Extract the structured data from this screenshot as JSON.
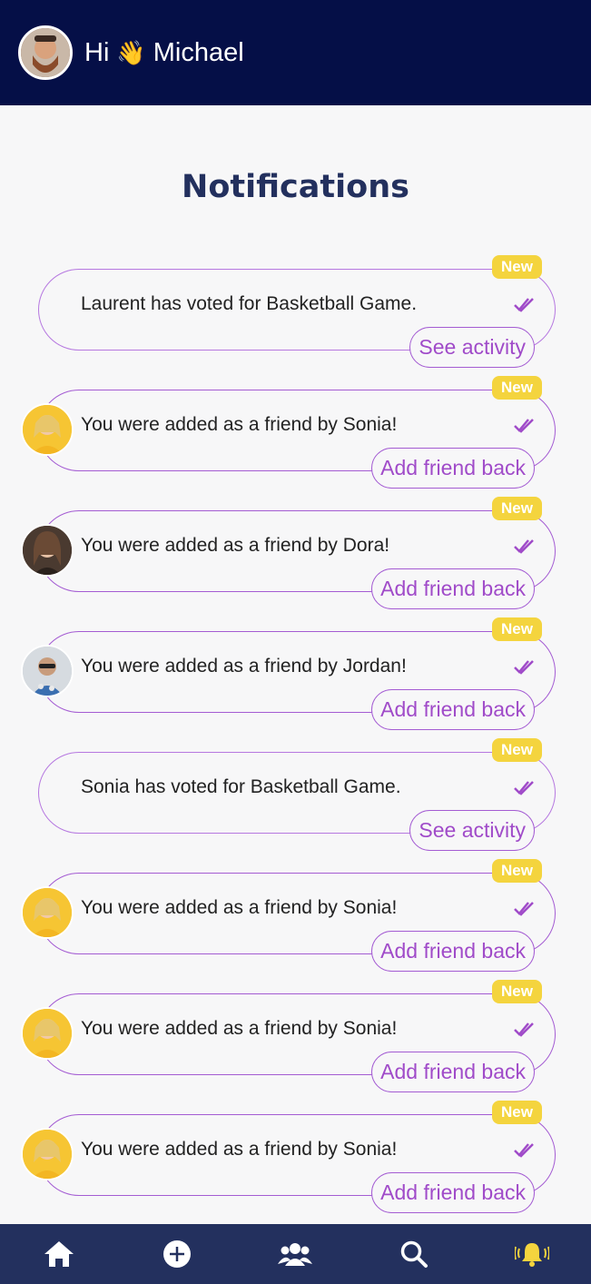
{
  "header": {
    "greeting_prefix": "Hi",
    "wave_emoji": "👋",
    "user_name": "Michael"
  },
  "page": {
    "title": "Notifications"
  },
  "notifications": [
    {
      "message": "Laurent has voted for Basketball Game.",
      "badge": "New",
      "action": "See activity",
      "avatar": "none"
    },
    {
      "message": "You were added as a friend by Sonia!",
      "badge": "New",
      "action": "Add friend back",
      "avatar": "sonia"
    },
    {
      "message": "You were added as a friend by Dora!",
      "badge": "New",
      "action": "Add friend back",
      "avatar": "dora"
    },
    {
      "message": "You were added as a friend by Jordan!",
      "badge": "New",
      "action": "Add friend back",
      "avatar": "jordan"
    },
    {
      "message": "Sonia has voted for Basketball Game.",
      "badge": "New",
      "action": "See activity",
      "avatar": "none"
    },
    {
      "message": "You were added as a friend by Sonia!",
      "badge": "New",
      "action": "Add friend back",
      "avatar": "sonia"
    },
    {
      "message": "You were added as a friend by Sonia!",
      "badge": "New",
      "action": "Add friend back",
      "avatar": "sonia"
    },
    {
      "message": "You were added as a friend by Sonia!",
      "badge": "New",
      "action": "Add friend back",
      "avatar": "sonia"
    }
  ],
  "nav": {
    "items": [
      "home-icon",
      "add-icon",
      "friends-icon",
      "search-icon",
      "bell-icon"
    ],
    "active": "bell-icon",
    "active_color": "#f4d43e"
  },
  "colors": {
    "header_bg": "#050f47",
    "nav_bg": "#23305e",
    "accent_purple": "#a04bc9",
    "badge_yellow": "#f4d43e",
    "title_navy": "#23305e"
  }
}
